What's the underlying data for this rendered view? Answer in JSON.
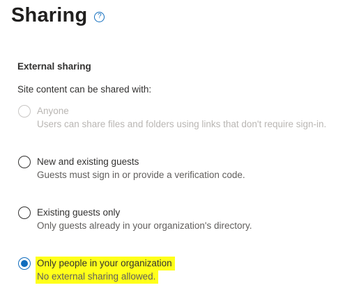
{
  "page": {
    "title": "Sharing",
    "help_icon": "help-circle-icon"
  },
  "external_sharing": {
    "heading": "External sharing",
    "subtext": "Site content can be shared with:",
    "options": [
      {
        "label": "Anyone",
        "description": "Users can share files and folders using links that don't require sign-in.",
        "state": "disabled"
      },
      {
        "label": "New and existing guests",
        "description": "Guests must sign in or provide a verification code.",
        "state": "unselected"
      },
      {
        "label": "Existing guests only",
        "description": "Only guests already in your organization's directory.",
        "state": "unselected"
      },
      {
        "label": "Only people in your organization",
        "description": "No external sharing allowed.",
        "state": "selected",
        "highlighted": true
      }
    ]
  },
  "colors": {
    "accent": "#0f6cbd",
    "highlight": "#ffff1a",
    "disabled_text": "#b9b6b3"
  }
}
